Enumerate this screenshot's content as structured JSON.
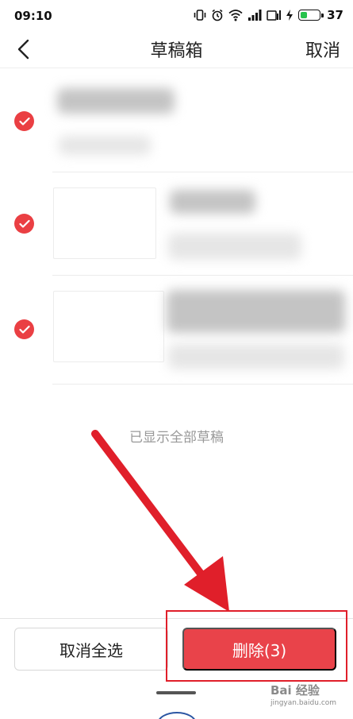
{
  "status_bar": {
    "time": "09:10",
    "battery_text": "37",
    "battery_level": 0.37
  },
  "header": {
    "title": "草稿箱",
    "cancel_label": "取消"
  },
  "drafts": [
    {
      "selected": true,
      "has_thumbnail": false
    },
    {
      "selected": true,
      "has_thumbnail": true
    },
    {
      "selected": true,
      "has_thumbnail": true
    }
  ],
  "list_footer": "已显示全部草稿",
  "bottom_bar": {
    "deselect_all_label": "取消全选",
    "delete_label": "删除(3)"
  },
  "watermark": {
    "text": "Bai 经验",
    "sub": "jingyan.baidu.com"
  },
  "colors": {
    "accent": "#e9434a",
    "check": "#ea3f43",
    "annotation": "#e01f2a",
    "battery": "#27c24c"
  }
}
